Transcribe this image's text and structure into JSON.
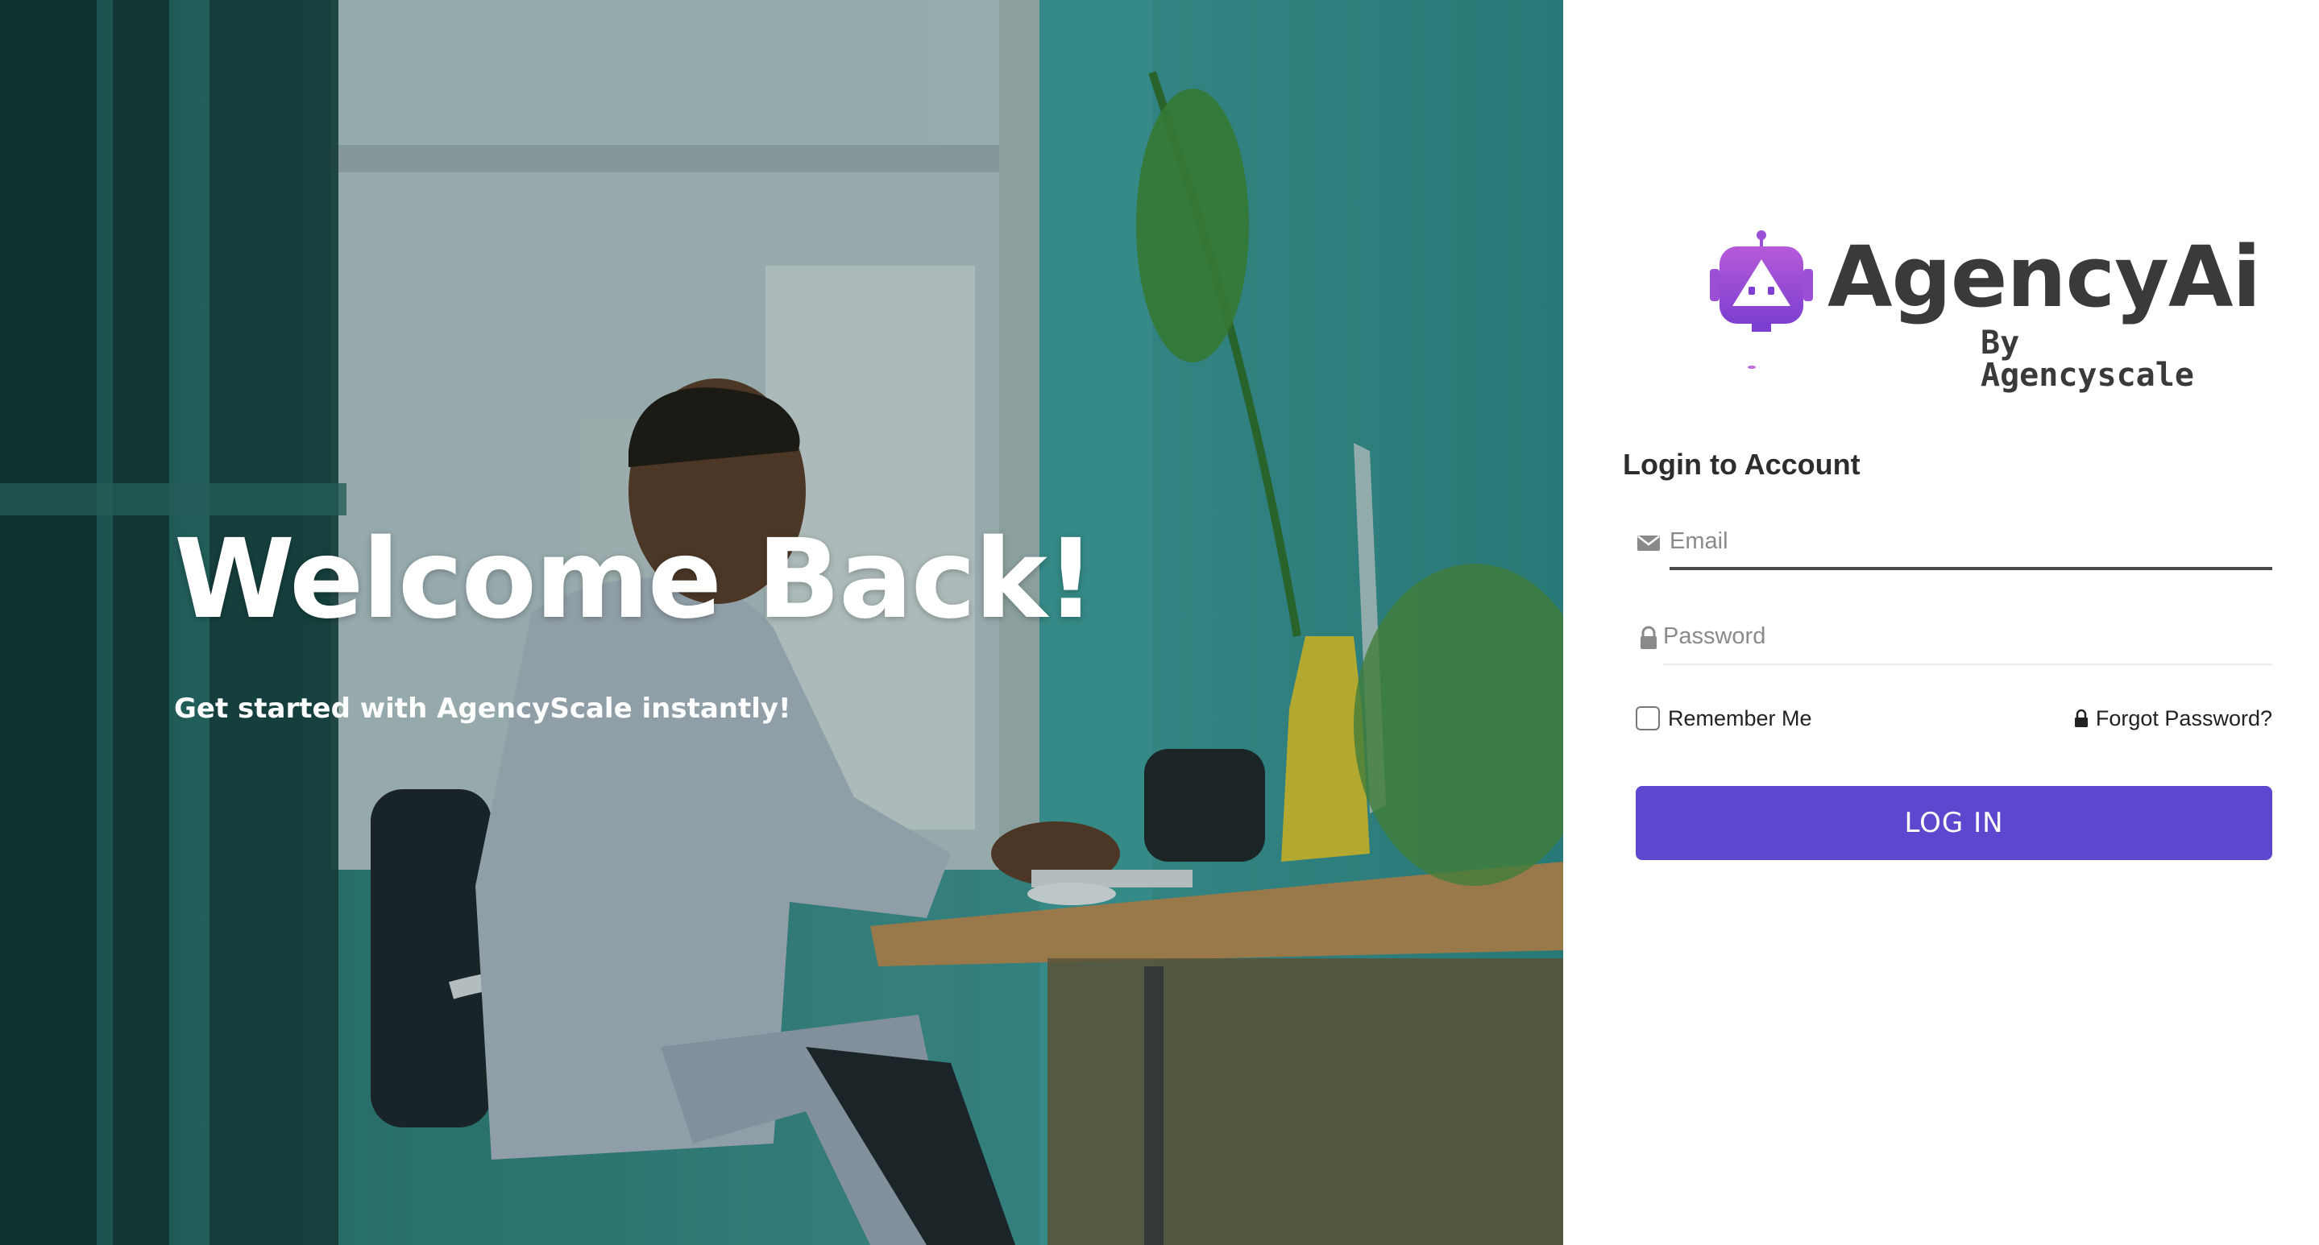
{
  "hero": {
    "title": "Welcome Back!",
    "subtitle": "Get started with AgencyScale instantly!",
    "image_description_icon": "office-photo"
  },
  "brand": {
    "logo_text": "AgencyAi",
    "logo_subtext": "By Agencyscale",
    "logo_icon": "robot-icon",
    "accent_color": "#9b4fd6"
  },
  "login": {
    "heading": "Login to Account",
    "email": {
      "placeholder": "Email",
      "value": "",
      "icon": "envelope-icon"
    },
    "password": {
      "placeholder": "Password",
      "value": "",
      "icon": "lock-icon"
    },
    "remember_label": "Remember Me",
    "remember_checked": false,
    "forgot_label": "Forgot Password?",
    "submit_label": "LOG IN",
    "button_color": "#5d47cf"
  }
}
